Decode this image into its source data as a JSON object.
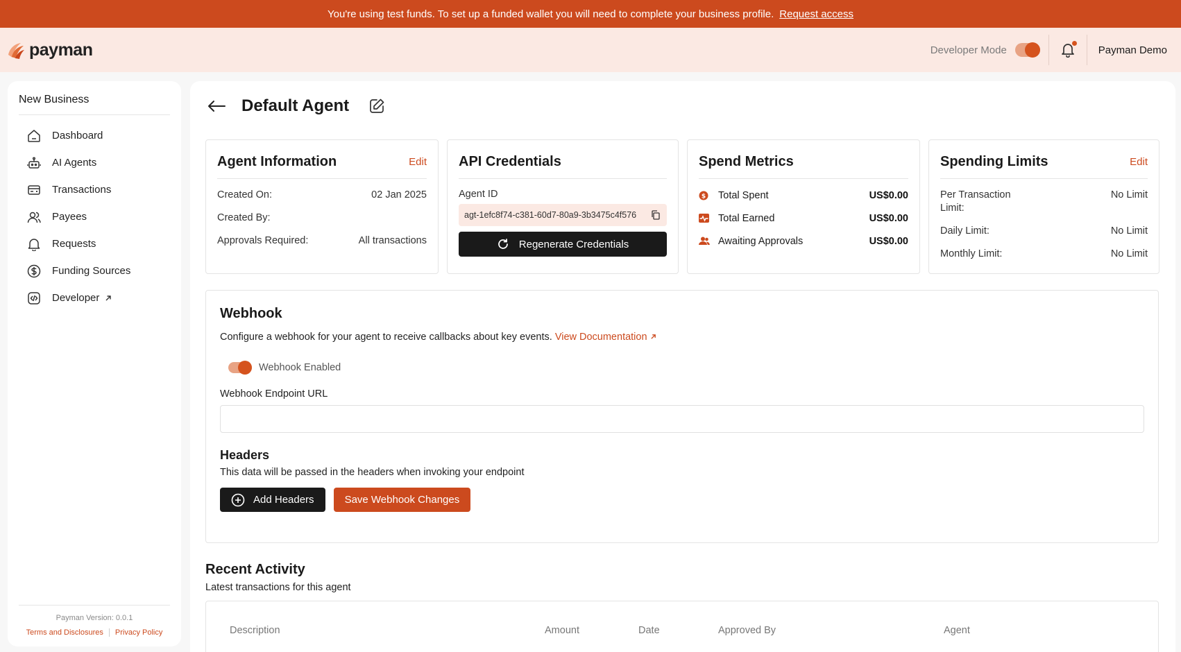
{
  "banner": {
    "message": "You're using test funds. To set up a funded wallet you will need to complete your business profile.",
    "link": "Request access"
  },
  "header": {
    "brand": "payman",
    "developer_mode_label": "Developer Mode",
    "developer_mode_on": true,
    "user_name": "Payman Demo"
  },
  "sidebar": {
    "business_name": "New Business",
    "items": [
      {
        "label": "Dashboard",
        "icon": "home-icon"
      },
      {
        "label": "AI Agents",
        "icon": "robot-icon"
      },
      {
        "label": "Transactions",
        "icon": "card-icon"
      },
      {
        "label": "Payees",
        "icon": "users-icon"
      },
      {
        "label": "Requests",
        "icon": "bell-icon"
      },
      {
        "label": "Funding Sources",
        "icon": "dollar-circle-icon"
      },
      {
        "label": "Developer",
        "icon": "code-icon"
      }
    ],
    "version": "Payman Version: 0.0.1",
    "terms": "Terms and Disclosures",
    "privacy": "Privacy Policy"
  },
  "page": {
    "title": "Default Agent"
  },
  "agent_info": {
    "title": "Agent Information",
    "edit": "Edit",
    "created_on_label": "Created On:",
    "created_on": "02 Jan 2025",
    "created_by_label": "Created By:",
    "created_by": "",
    "approvals_label": "Approvals Required:",
    "approvals": "All transactions"
  },
  "api_credentials": {
    "title": "API Credentials",
    "agent_id_label": "Agent ID",
    "agent_id": "agt-1efc8f74-c381-60d7-80a9-3b3475c4f576",
    "regenerate": "Regenerate Credentials"
  },
  "spend_metrics": {
    "title": "Spend Metrics",
    "rows": [
      {
        "label": "Total Spent",
        "value": "US$0.00"
      },
      {
        "label": "Total Earned",
        "value": "US$0.00"
      },
      {
        "label": "Awaiting Approvals",
        "value": "US$0.00"
      }
    ]
  },
  "spending_limits": {
    "title": "Spending Limits",
    "edit": "Edit",
    "per_tx_label": "Per Transaction Limit:",
    "per_tx": "No Limit",
    "daily_label": "Daily Limit:",
    "daily": "No Limit",
    "monthly_label": "Monthly Limit:",
    "monthly": "No Limit"
  },
  "webhook": {
    "title": "Webhook",
    "description": "Configure a webhook for your agent to receive callbacks about key events.",
    "doc_link": "View Documentation",
    "enabled_label": "Webhook Enabled",
    "enabled": true,
    "endpoint_label": "Webhook Endpoint URL",
    "endpoint_value": "",
    "headers_title": "Headers",
    "headers_desc": "This data will be passed in the headers when invoking your endpoint",
    "add_headers": "Add Headers",
    "save": "Save Webhook Changes"
  },
  "recent_activity": {
    "title": "Recent Activity",
    "subtitle": "Latest transactions for this agent",
    "columns": [
      "Description",
      "Amount",
      "Date",
      "Approved By",
      "Agent"
    ]
  },
  "colors": {
    "accent": "#cc4a1e",
    "banner_bg": "#cc4a1e",
    "header_bg": "#fbe9e3",
    "dark_button": "#1a1a1a"
  }
}
